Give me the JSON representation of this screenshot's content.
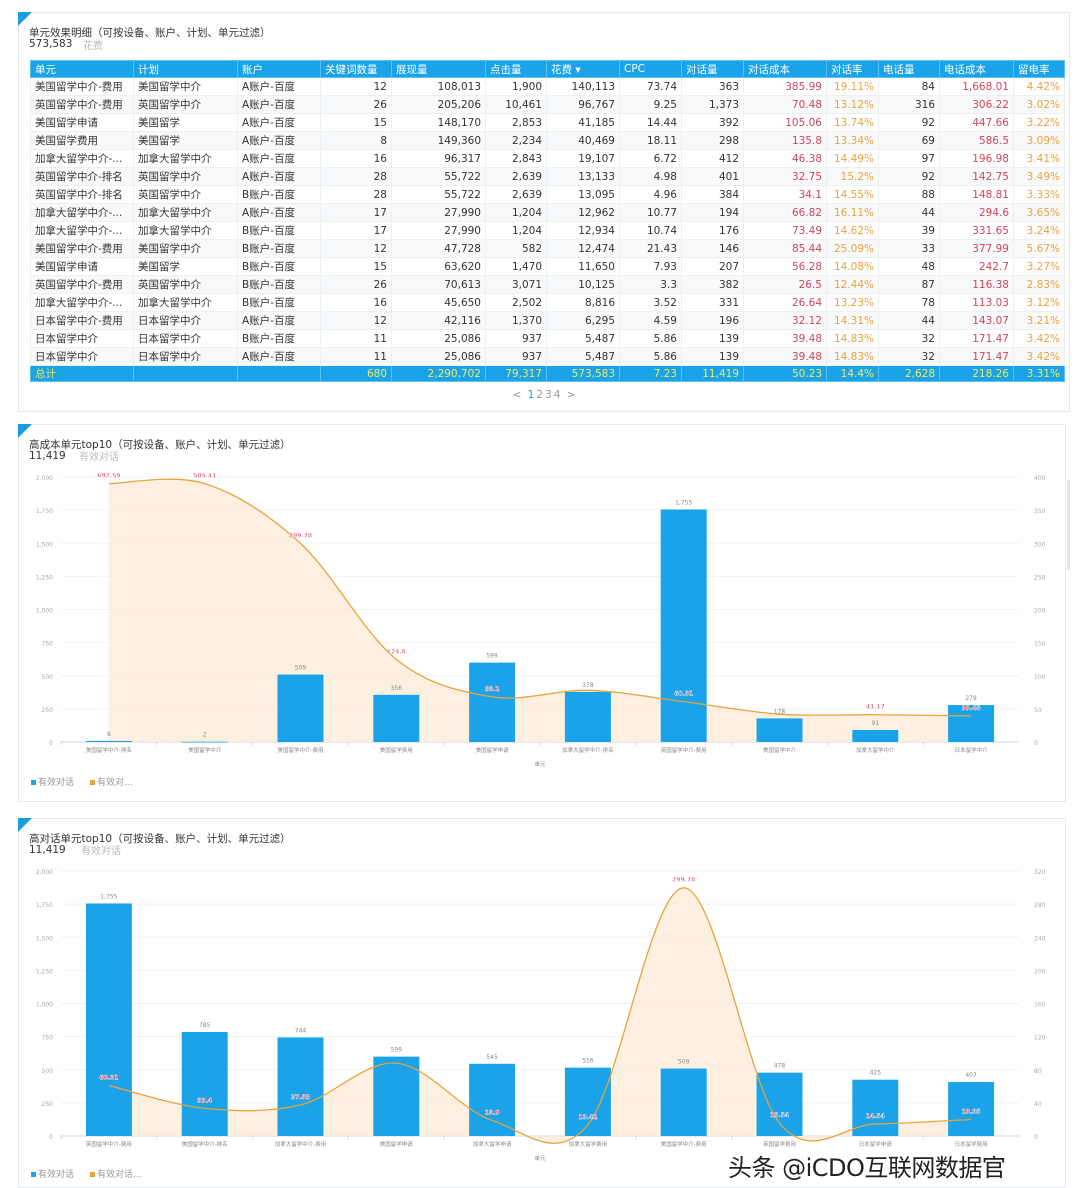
{
  "table_panel": {
    "title": "单元效果明细（可按设备、账户、计划、单元过滤）",
    "value": "573,583",
    "metric": "花费",
    "columns": [
      "单元",
      "计划",
      "账户",
      "关键词数量",
      "展现量",
      "点击量",
      "花费 ▾",
      "CPC",
      "对话量",
      "对话成本",
      "对话率",
      "电话量",
      "电话成本",
      "留电率"
    ],
    "rows": [
      [
        "美国留学中介-费用",
        "美国留学中介",
        "A账户-百度",
        "12",
        "108,013",
        "1,900",
        "140,113",
        "73.74",
        "363",
        "385.99",
        "19.11%",
        "84",
        "1,668.01",
        "4.42%"
      ],
      [
        "英国留学中介-费用",
        "英国留学中介",
        "A账户-百度",
        "26",
        "205,206",
        "10,461",
        "96,767",
        "9.25",
        "1,373",
        "70.48",
        "13.12%",
        "316",
        "306.22",
        "3.02%"
      ],
      [
        "美国留学申请",
        "美国留学",
        "A账户-百度",
        "15",
        "148,170",
        "2,853",
        "41,185",
        "14.44",
        "392",
        "105.06",
        "13.74%",
        "92",
        "447.66",
        "3.22%"
      ],
      [
        "美国留学费用",
        "美国留学",
        "A账户-百度",
        "8",
        "149,360",
        "2,234",
        "40,469",
        "18.11",
        "298",
        "135.8",
        "13.34%",
        "69",
        "586.5",
        "3.09%"
      ],
      [
        "加拿大留学中介-...",
        "加拿大留学中介",
        "A账户-百度",
        "16",
        "96,317",
        "2,843",
        "19,107",
        "6.72",
        "412",
        "46.38",
        "14.49%",
        "97",
        "196.98",
        "3.41%"
      ],
      [
        "英国留学中介-排名",
        "英国留学中介",
        "A账户-百度",
        "28",
        "55,722",
        "2,639",
        "13,133",
        "4.98",
        "401",
        "32.75",
        "15.2%",
        "92",
        "142.75",
        "3.49%"
      ],
      [
        "英国留学中介-排名",
        "英国留学中介",
        "B账户-百度",
        "28",
        "55,722",
        "2,639",
        "13,095",
        "4.96",
        "384",
        "34.1",
        "14.55%",
        "88",
        "148.81",
        "3.33%"
      ],
      [
        "加拿大留学中介-...",
        "加拿大留学中介",
        "A账户-百度",
        "17",
        "27,990",
        "1,204",
        "12,962",
        "10.77",
        "194",
        "66.82",
        "16.11%",
        "44",
        "294.6",
        "3.65%"
      ],
      [
        "加拿大留学中介-...",
        "加拿大留学中介",
        "B账户-百度",
        "17",
        "27,990",
        "1,204",
        "12,934",
        "10.74",
        "176",
        "73.49",
        "14.62%",
        "39",
        "331.65",
        "3.24%"
      ],
      [
        "美国留学中介-费用",
        "美国留学中介",
        "B账户-百度",
        "12",
        "47,728",
        "582",
        "12,474",
        "21.43",
        "146",
        "85.44",
        "25.09%",
        "33",
        "377.99",
        "5.67%"
      ],
      [
        "美国留学申请",
        "美国留学",
        "B账户-百度",
        "15",
        "63,620",
        "1,470",
        "11,650",
        "7.93",
        "207",
        "56.28",
        "14.08%",
        "48",
        "242.7",
        "3.27%"
      ],
      [
        "英国留学中介-费用",
        "英国留学中介",
        "B账户-百度",
        "26",
        "70,613",
        "3,071",
        "10,125",
        "3.3",
        "382",
        "26.5",
        "12.44%",
        "87",
        "116.38",
        "2.83%"
      ],
      [
        "加拿大留学中介-...",
        "加拿大留学中介",
        "B账户-百度",
        "16",
        "45,650",
        "2,502",
        "8,816",
        "3.52",
        "331",
        "26.64",
        "13.23%",
        "78",
        "113.03",
        "3.12%"
      ],
      [
        "日本留学中介-费用",
        "日本留学中介",
        "A账户-百度",
        "12",
        "42,116",
        "1,370",
        "6,295",
        "4.59",
        "196",
        "32.12",
        "14.31%",
        "44",
        "143.07",
        "3.21%"
      ],
      [
        "日本留学中介",
        "日本留学中介",
        "B账户-百度",
        "11",
        "25,086",
        "937",
        "5,487",
        "5.86",
        "139",
        "39.48",
        "14.83%",
        "32",
        "171.47",
        "3.42%"
      ],
      [
        "日本留学中介",
        "日本留学中介",
        "A账户-百度",
        "11",
        "25,086",
        "937",
        "5,487",
        "5.86",
        "139",
        "39.48",
        "14.83%",
        "32",
        "171.47",
        "3.42%"
      ]
    ],
    "total": [
      "总计",
      "",
      "",
      "680",
      "2,290,702",
      "79,317",
      "573,583",
      "7.23",
      "11,419",
      "50.23",
      "14.4%",
      "2,628",
      "218.26",
      "3.31%"
    ],
    "pagination": {
      "prev": "<",
      "pages": [
        "1",
        "2",
        "3",
        "4"
      ],
      "current": "1",
      "next": ">"
    }
  },
  "colors": {
    "bar": "#1aa3e8",
    "line": "#e8a33d",
    "area": "#fdebd6",
    "cost_text": "#d0455a",
    "rate_text": "#e8a33d",
    "total_text": "#f3ea5a"
  },
  "chart_panels": [
    {
      "title": "高成本单元top10（可按设备、账户、计划、单元过滤）",
      "value": "11,419",
      "metric": "有效对话",
      "legend": [
        "有效对话",
        "有效对..."
      ]
    },
    {
      "title": "高对话单元top10（可按设备、账户、计划、单元过滤）",
      "value": "11,419",
      "metric": "有效对话",
      "legend": [
        "有效对话",
        "有效对话..."
      ]
    }
  ],
  "chart_data": [
    {
      "type": "bar+area-line",
      "xlabel": "单元",
      "categories": [
        "美国留学中介-排名",
        "美国留学中介",
        "美国留学中介-费用",
        "美国留学费用",
        "美国留学申请",
        "加拿大留学中介-排名",
        "英国留学中介-费用",
        "美国留学中介",
        "加拿大留学中介",
        "日本留学中介"
      ],
      "series": [
        {
          "name": "有效对话",
          "type": "bar",
          "axis": "left",
          "values": [
            8,
            2,
            509,
            356,
            599,
            378,
            1755,
            178,
            91,
            279
          ],
          "labels": [
            "8",
            "2",
            "509",
            "356",
            "599",
            "378",
            "1,755",
            "178",
            "91",
            "279"
          ]
        },
        {
          "name": "有效对...",
          "type": "line",
          "axis": "right",
          "values": [
            692.59,
            505.41,
            299.78,
            124.8,
            68.2,
            78,
            60.91,
            42,
            41.17,
            39.48
          ],
          "labels": [
            "692.59",
            "505.41",
            "299.78",
            "124.8",
            "68.2",
            "",
            "60.91",
            "",
            "41.17",
            "39.48"
          ]
        }
      ],
      "ylim_left": [
        0,
        2000
      ],
      "yticks_left": [
        "0",
        "250",
        "500",
        "750",
        "1,000",
        "1,250",
        "1,500",
        "1,750",
        "2,000"
      ],
      "ylim_right": [
        0,
        400
      ],
      "yticks_right": [
        "0",
        "50",
        "100",
        "150",
        "200",
        "250",
        "300",
        "350",
        "400"
      ],
      "grid": true,
      "legend": "bottom-left"
    },
    {
      "type": "bar+area-line",
      "xlabel": "单元",
      "categories": [
        "英国留学中介-费用",
        "美国留学中介-排名",
        "加拿大留学中介-费用",
        "美国留学申请",
        "加拿大留学申请",
        "加拿大留学费用",
        "美国留学中介-费用",
        "英国留学费用",
        "日本留学申请",
        "日本留学费用"
      ],
      "series": [
        {
          "name": "有效对话",
          "type": "bar",
          "axis": "left",
          "values": [
            1755,
            785,
            744,
            599,
            545,
            516,
            509,
            478,
            425,
            407
          ],
          "labels": [
            "1,755",
            "785",
            "744",
            "599",
            "545",
            "516",
            "509",
            "478",
            "425",
            "407"
          ]
        },
        {
          "name": "有效对话...",
          "type": "line",
          "axis": "right",
          "values": [
            60.91,
            33.4,
            37.53,
            88,
            18.9,
            13.42,
            299.78,
            15.54,
            14.54,
            19.95
          ],
          "labels": [
            "60.91",
            "33.4",
            "37.53",
            "",
            "18.9",
            "13.42",
            "299.78",
            "15.54",
            "14.54",
            "19.95"
          ]
        }
      ],
      "ylim_left": [
        0,
        2000
      ],
      "yticks_left": [
        "0",
        "250",
        "500",
        "750",
        "1,000",
        "1,250",
        "1,500",
        "1,750",
        "2,000"
      ],
      "ylim_right": [
        0,
        320
      ],
      "yticks_right": [
        "0",
        "40",
        "80",
        "120",
        "160",
        "200",
        "240",
        "280",
        "320"
      ],
      "grid": true,
      "legend": "bottom-left"
    }
  ],
  "watermark": "头条 @iCDO互联网数据官"
}
